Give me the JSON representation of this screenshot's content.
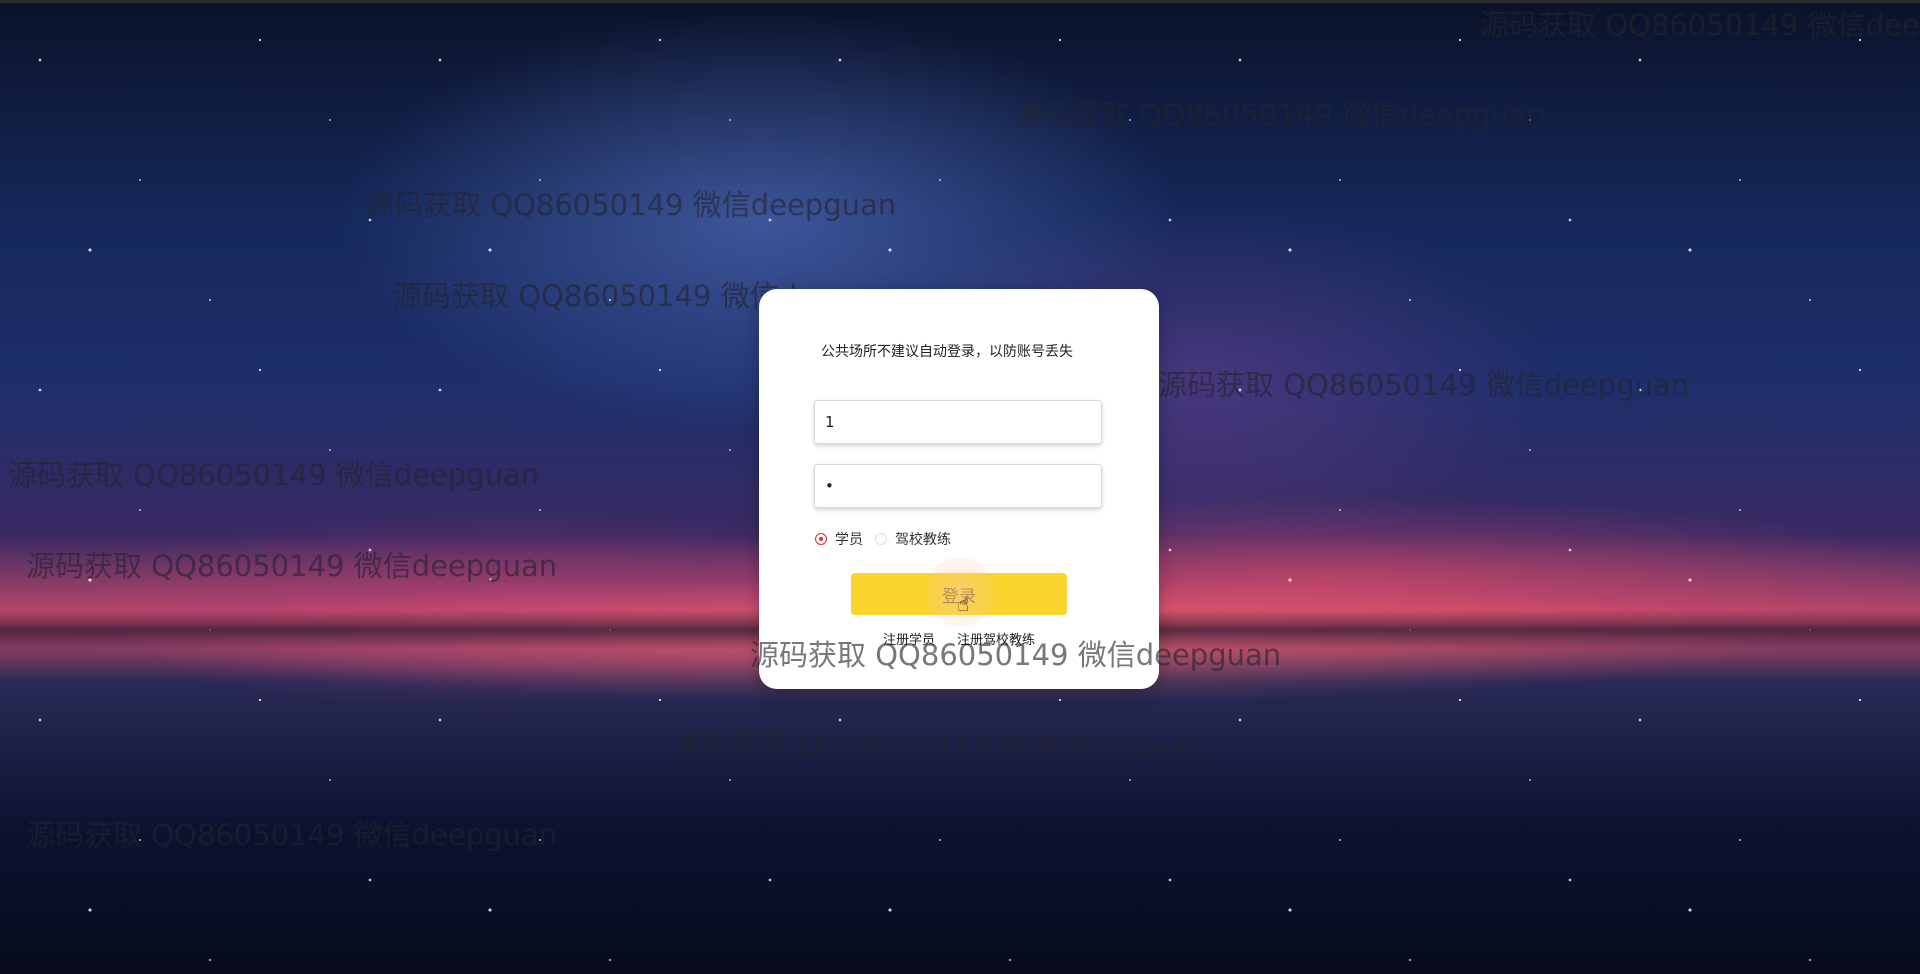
{
  "watermark_text": "源码获取 QQ86050149 微信deepguan",
  "login": {
    "notice": "公共场所不建议自动登录，以防账号丢失",
    "username_value": "1",
    "password_value": "•",
    "roles": [
      {
        "label": "学员",
        "checked": true
      },
      {
        "label": "驾校教练",
        "checked": false
      }
    ],
    "login_label": "登录",
    "links": [
      "注册学员",
      "注册驾校教练"
    ]
  },
  "colors": {
    "login_button": "#f8d42c",
    "radio_selected": "#e03030",
    "card_bg": "#ffffff"
  }
}
